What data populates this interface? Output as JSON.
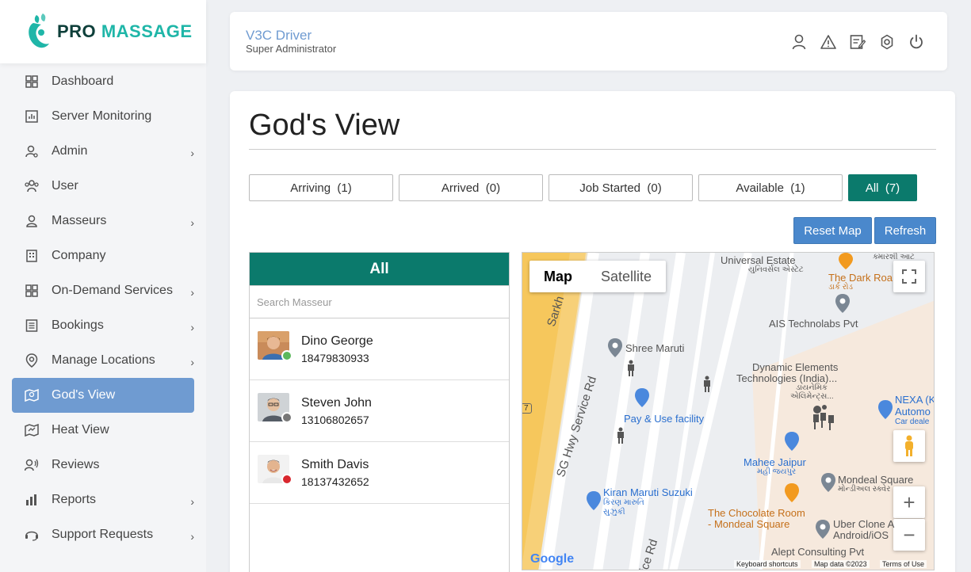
{
  "brand": {
    "pro": "PRO",
    "massage": "MASSAGE"
  },
  "sidebar": {
    "items": [
      {
        "label": "Dashboard",
        "icon": "dashboard-icon",
        "chevron": false
      },
      {
        "label": "Server Monitoring",
        "icon": "chart-icon",
        "chevron": false
      },
      {
        "label": "Admin",
        "icon": "admin-icon",
        "chevron": true
      },
      {
        "label": "User",
        "icon": "users-icon",
        "chevron": false
      },
      {
        "label": "Masseurs",
        "icon": "person-icon",
        "chevron": true
      },
      {
        "label": "Company",
        "icon": "building-icon",
        "chevron": false
      },
      {
        "label": "On-Demand Services",
        "icon": "grid-icon",
        "chevron": true
      },
      {
        "label": "Bookings",
        "icon": "list-icon",
        "chevron": true
      },
      {
        "label": "Manage Locations",
        "icon": "location-icon",
        "chevron": true
      },
      {
        "label": "God's View",
        "icon": "map-view-icon",
        "chevron": false,
        "active": true
      },
      {
        "label": "Heat View",
        "icon": "heat-map-icon",
        "chevron": false
      },
      {
        "label": "Reviews",
        "icon": "review-icon",
        "chevron": false
      },
      {
        "label": "Reports",
        "icon": "bar-chart-icon",
        "chevron": true
      },
      {
        "label": "Support Requests",
        "icon": "headset-icon",
        "chevron": true
      }
    ]
  },
  "header": {
    "user_name": "V3C Driver",
    "user_role": "Super Administrator",
    "icons": [
      "profile-icon",
      "alert-icon",
      "edit-icon",
      "settings-icon",
      "power-icon"
    ]
  },
  "main": {
    "title": "God's View",
    "filters": [
      {
        "label": "Arriving",
        "count": "(1)"
      },
      {
        "label": "Arrived",
        "count": "(0)"
      },
      {
        "label": "Job Started",
        "count": "(0)"
      },
      {
        "label": "Available",
        "count": "(1)"
      },
      {
        "label": "All",
        "count": "(7)",
        "active": true
      }
    ],
    "reset_map": "Reset Map",
    "refresh": "Refresh"
  },
  "list": {
    "header": "All",
    "search_placeholder": "Search Masseur",
    "masseurs": [
      {
        "name": "Dino George",
        "phone": "18479830933",
        "status_color": "#5cb85c"
      },
      {
        "name": "Steven John",
        "phone": "13106802657",
        "status_color": "#777777"
      },
      {
        "name": "Smith Davis",
        "phone": "18137432652",
        "status_color": "#d9272e"
      }
    ]
  },
  "map": {
    "tab_map": "Map",
    "tab_satellite": "Satellite",
    "labels": {
      "universal_estate": "Universal Estate",
      "universal_estate_gu": "યુનિવર્સલ એસ્ટેટ",
      "komalsh": "ક્મારશી આટ",
      "dark_road": "The Dark Roa",
      "dark_road_gu": "ડાર્ક રોડ",
      "ais": "AIS Technolabs Pvt",
      "shree_maruti": "Shree Maruti",
      "dynamic": "Dynamic Elements",
      "dynamic2": "Technologies (India)...",
      "dynamic_gu": "ડાયનેમિક",
      "dynamic_gu2": "એલિમેન્ટ્સ...",
      "nexa": "NEXA (K",
      "nexa2": "Automo",
      "nexa3": "Car deale",
      "pay_use": "Pay & Use facility",
      "sg_hwy": "SG Hwy Service Rd",
      "sarkhej": "Sarkh",
      "mahee": "Mahee Jaipur",
      "mahee_gu": "મહી જયપુર",
      "mondeal": "Mondeal Square",
      "mondeal_gu": "મોન્ડીઅલ સ્ક્વેર",
      "kiran": "Kiran Maruti Suzuki",
      "kiran_gu": "કિરણ મારુતિ",
      "kiran_gu2": "સુઝુકી",
      "chocolate": "The Chocolate Room",
      "chocolate2": "- Mondeal Square",
      "uber": "Uber Clone A",
      "uber2": "Android/iOS",
      "alept": "Alept Consulting Pvt",
      "rd": "ice Rd",
      "road_num": "7",
      "google": "Google",
      "keyboard": "Keyboard shortcuts",
      "map_data": "Map data ©2023",
      "terms": "Terms of Use"
    }
  }
}
